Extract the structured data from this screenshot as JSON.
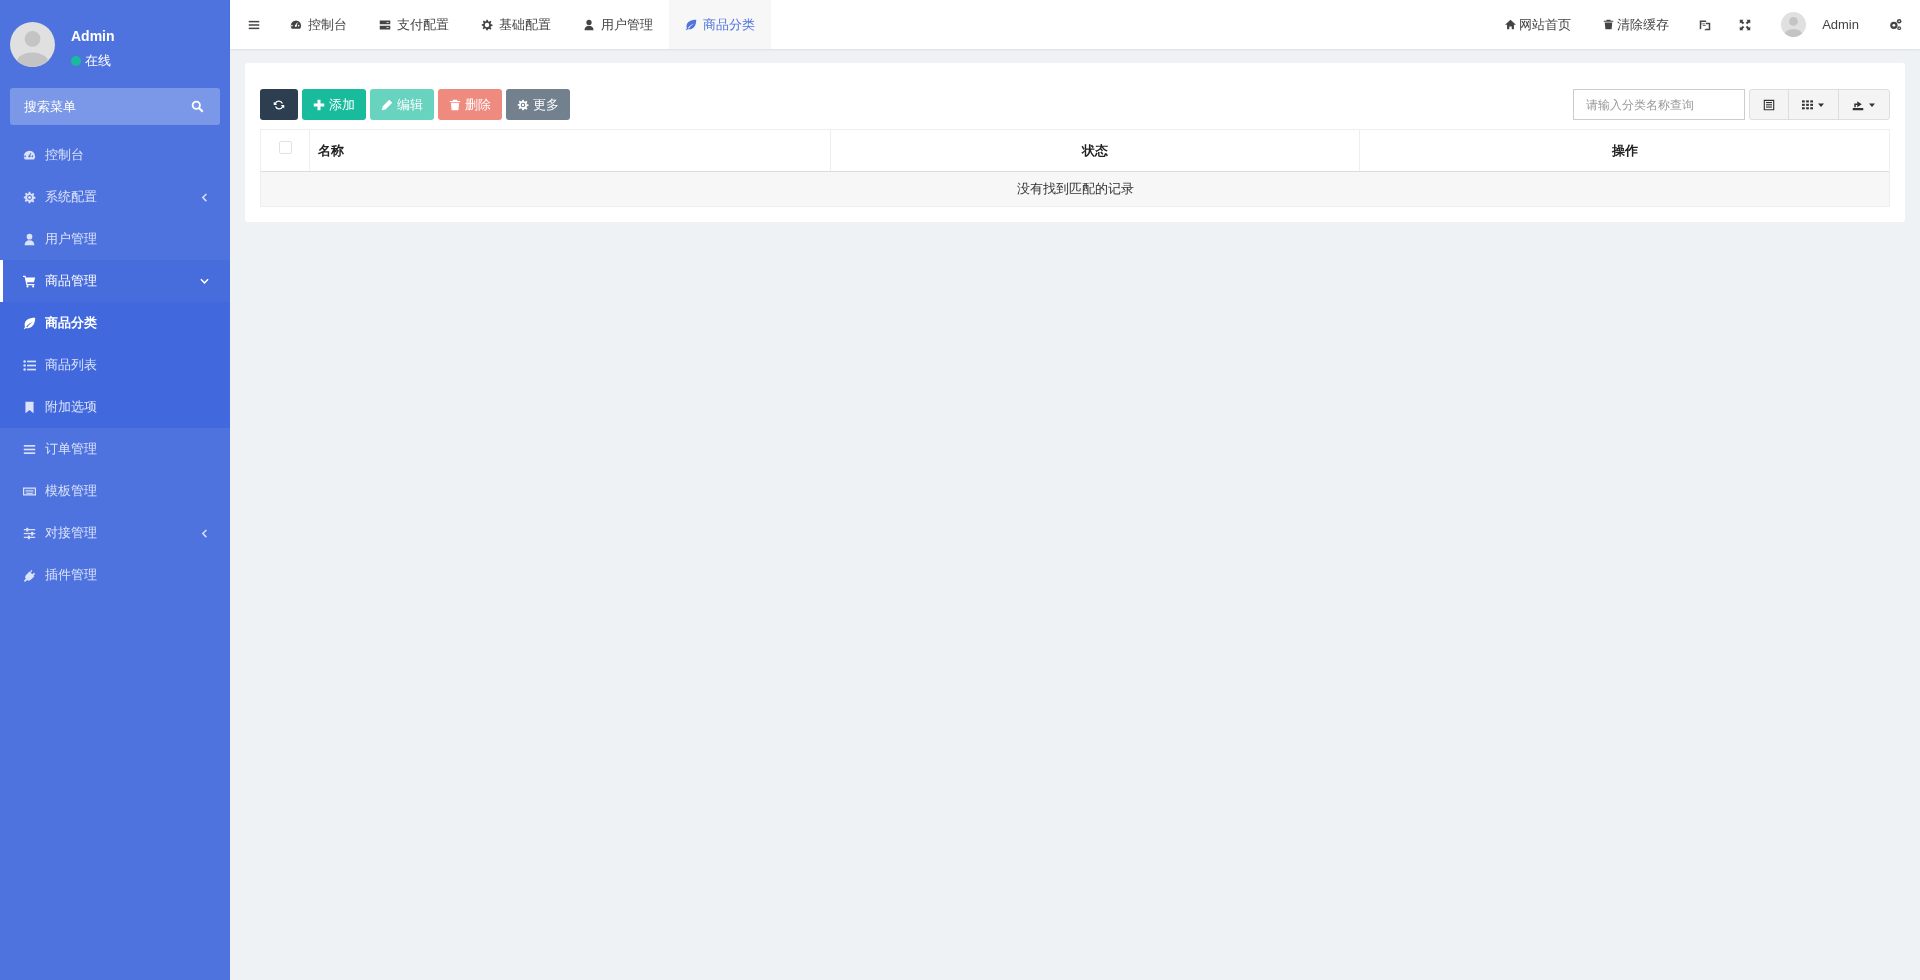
{
  "sidebar": {
    "user": {
      "name": "Admin",
      "status": "在线"
    },
    "search": {
      "placeholder": "搜索菜单"
    },
    "items": [
      {
        "label": "控制台",
        "kind": "link",
        "selected": false
      },
      {
        "label": "系统配置",
        "kind": "group",
        "selected": false,
        "expanded": false
      },
      {
        "label": "用户管理",
        "kind": "link",
        "selected": false
      },
      {
        "label": "商品管理",
        "kind": "group",
        "selected": true,
        "expanded": true,
        "children": [
          {
            "label": "商品分类",
            "selected": true
          },
          {
            "label": "商品列表",
            "selected": false
          },
          {
            "label": "附加选项",
            "selected": false
          }
        ]
      },
      {
        "label": "订单管理",
        "kind": "link",
        "selected": false
      },
      {
        "label": "模板管理",
        "kind": "link",
        "selected": false
      },
      {
        "label": "对接管理",
        "kind": "group",
        "selected": false,
        "expanded": false
      },
      {
        "label": "插件管理",
        "kind": "link",
        "selected": false
      }
    ]
  },
  "tabs": [
    {
      "label": "控制台",
      "selected": false
    },
    {
      "label": "支付配置",
      "selected": false
    },
    {
      "label": "基础配置",
      "selected": false
    },
    {
      "label": "用户管理",
      "selected": false
    },
    {
      "label": "商品分类",
      "selected": true
    }
  ],
  "header_right": {
    "links": [
      "网站首页",
      "清除缓存"
    ],
    "user": "Admin"
  },
  "toolbar": {
    "buttons": [
      {
        "kind": "refresh",
        "disabled": false
      },
      {
        "kind": "add",
        "label": "添加",
        "disabled": false
      },
      {
        "kind": "edit",
        "label": "编辑",
        "disabled": true
      },
      {
        "kind": "delete",
        "label": "删除",
        "disabled": true
      },
      {
        "kind": "more",
        "label": "更多",
        "disabled": false
      }
    ],
    "search": {
      "placeholder": "请输入分类名称查询"
    }
  },
  "table": {
    "columns": [
      "名称",
      "状态",
      "操作"
    ],
    "select_all": {
      "checked": false
    },
    "empty_message": "没有找到匹配的记录"
  }
}
